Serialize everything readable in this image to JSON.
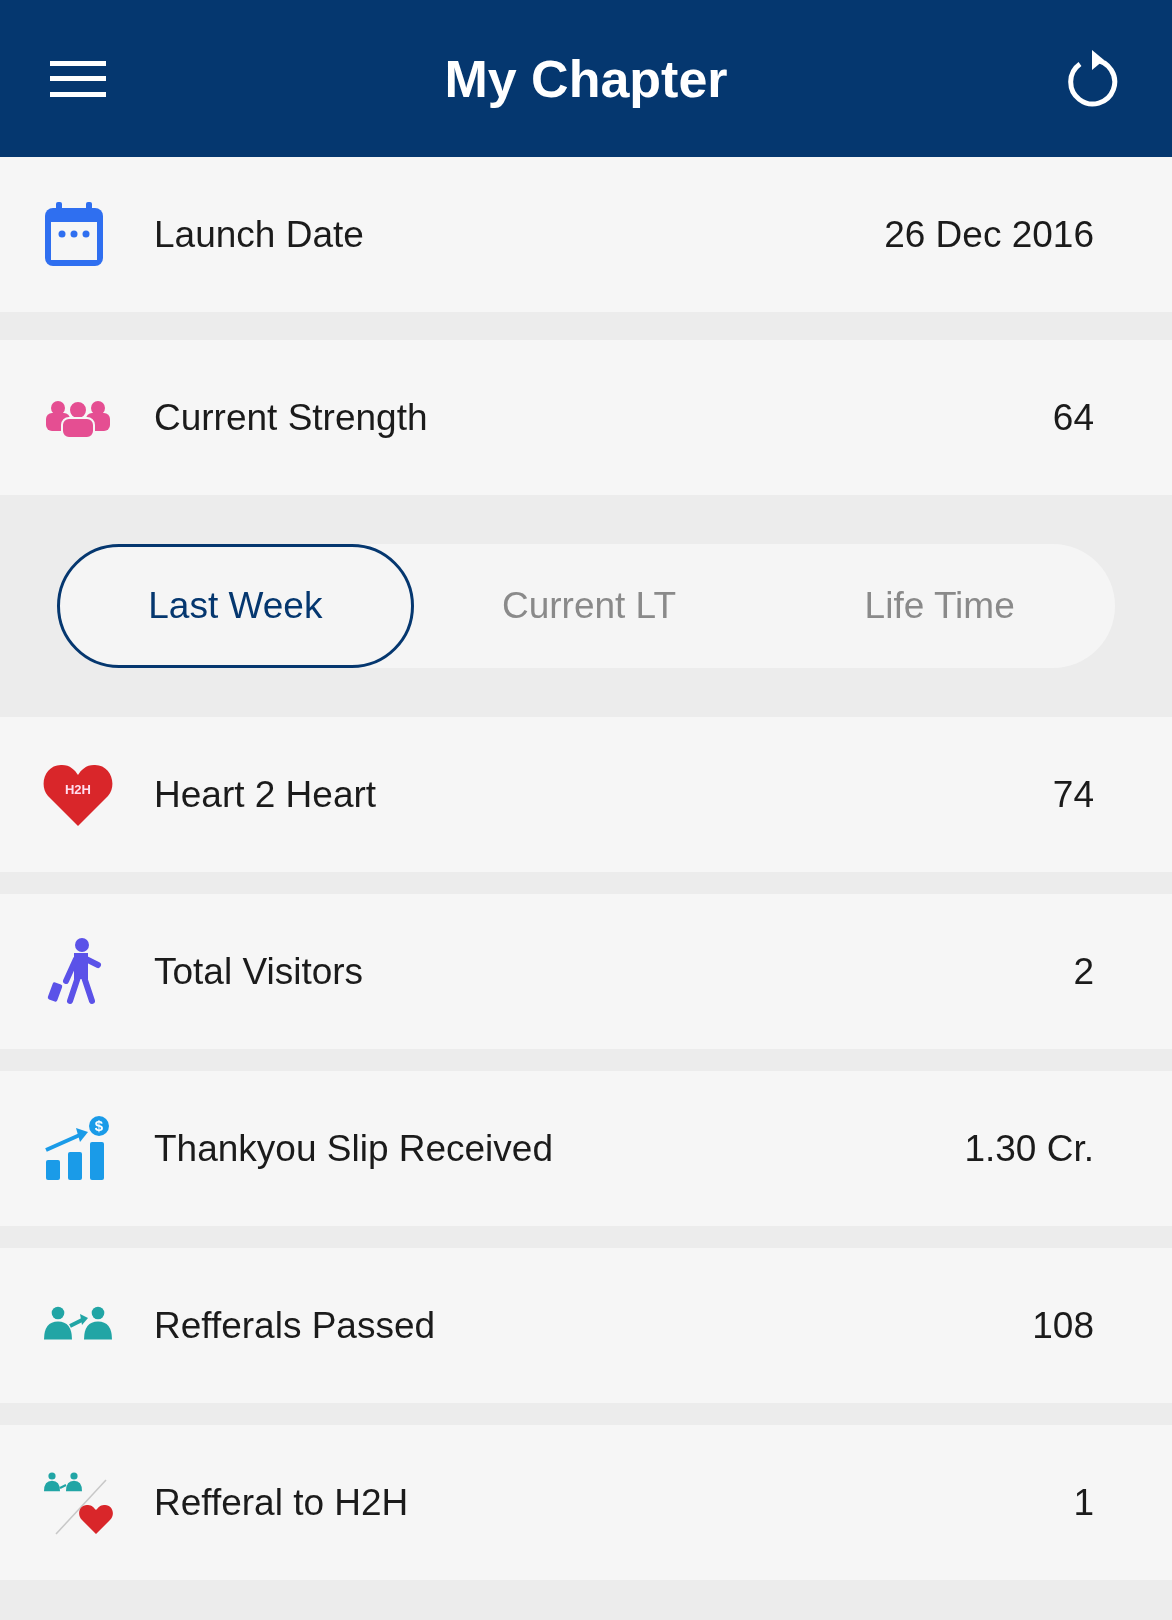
{
  "header": {
    "title": "My Chapter"
  },
  "summary": [
    {
      "label": "Launch Date",
      "value": "26 Dec 2016"
    },
    {
      "label": "Current Strength",
      "value": "64"
    }
  ],
  "tabs": [
    {
      "label": "Last Week",
      "selected": true
    },
    {
      "label": "Current LT",
      "selected": false
    },
    {
      "label": "Life Time",
      "selected": false
    }
  ],
  "stats": [
    {
      "icon_text": "H2H",
      "label": "Heart 2 Heart",
      "value": "74"
    },
    {
      "label": "Total Visitors",
      "value": "2"
    },
    {
      "icon_text": "$",
      "label": "Thankyou Slip Received",
      "value": "1.30 Cr."
    },
    {
      "label": "Refferals Passed",
      "value": "108"
    },
    {
      "label": "Refferal to H2H",
      "value": "1"
    }
  ]
}
